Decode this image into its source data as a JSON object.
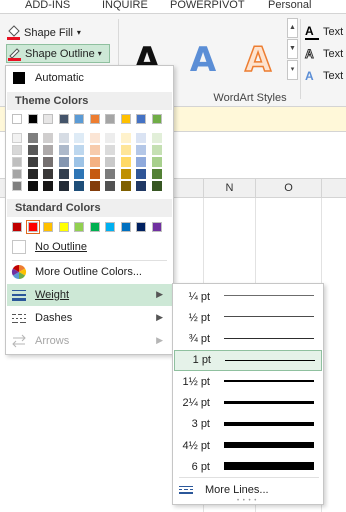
{
  "ribbon": {
    "tabs": [
      "ADD-INS",
      "INQUIRE",
      "POWERPIVOT",
      "Personal"
    ],
    "shape_fill_label": "Shape Fill",
    "shape_outline_label": "Shape Outline",
    "wordart_letter": "A",
    "text_commands": [
      "Text",
      "Text",
      "Text"
    ],
    "wordart_group_label": "WordArt Styles",
    "wordart_styles": [
      "black-plain",
      "blue-gradient",
      "orange-outline"
    ]
  },
  "sheet": {
    "columns": [
      "N",
      "O"
    ]
  },
  "outline_menu": {
    "automatic_label": "Automatic",
    "theme_colors_heading": "Theme Colors",
    "standard_colors_heading": "Standard Colors",
    "no_outline_label": "No Outline",
    "more_colors_label": "More Outline Colors...",
    "weight_label": "Weight",
    "dashes_label": "Dashes",
    "arrows_label": "Arrows",
    "theme_colors": [
      "#ffffff",
      "#000000",
      "#e7e6e6",
      "#44546a",
      "#5b9bd5",
      "#ed7d31",
      "#a5a5a5",
      "#ffc000",
      "#4472c4",
      "#70ad47"
    ],
    "theme_shades": [
      [
        "#f2f2f2",
        "#d8d8d8",
        "#bfbfbf",
        "#a5a5a5",
        "#7f7f7f"
      ],
      [
        "#7f7f7f",
        "#595959",
        "#3f3f3f",
        "#262626",
        "#0c0c0c"
      ],
      [
        "#d0cece",
        "#aeaaaa",
        "#757070",
        "#3a3838",
        "#171616"
      ],
      [
        "#d6dce4",
        "#adb9ca",
        "#8496b0",
        "#323f4f",
        "#222a35"
      ],
      [
        "#deebf6",
        "#bdd7ee",
        "#9dc3e6",
        "#2e75b5",
        "#1e4e79"
      ],
      [
        "#fbe5d5",
        "#f7cbac",
        "#f4b183",
        "#c55a11",
        "#833c0b"
      ],
      [
        "#ededed",
        "#dbdbdb",
        "#c9c9c9",
        "#7b7b7b",
        "#525252"
      ],
      [
        "#fff2cc",
        "#fee599",
        "#ffd965",
        "#bf9000",
        "#7f6000"
      ],
      [
        "#dae3f3",
        "#b4c7e7",
        "#8faadc",
        "#2f5597",
        "#203864"
      ],
      [
        "#e2efd9",
        "#c5e0b3",
        "#a8d08d",
        "#538135",
        "#375623"
      ]
    ],
    "standard_colors": [
      "#c00000",
      "#ff0000",
      "#ffc000",
      "#ffff00",
      "#92d050",
      "#00b050",
      "#00b0f0",
      "#0070c0",
      "#002060",
      "#7030a0"
    ],
    "selected_standard_color": "#ff0000"
  },
  "weight_menu": {
    "items": [
      {
        "label": "¼ pt",
        "weight": 0.25
      },
      {
        "label": "½ pt",
        "weight": 0.5
      },
      {
        "label": "¾ pt",
        "weight": 0.75
      },
      {
        "label": "1 pt",
        "weight": 1,
        "selected": true
      },
      {
        "label": "1½ pt",
        "weight": 1.5
      },
      {
        "label": "2¼ pt",
        "weight": 2.25
      },
      {
        "label": "3 pt",
        "weight": 3
      },
      {
        "label": "4½ pt",
        "weight": 4.5
      },
      {
        "label": "6 pt",
        "weight": 6
      }
    ],
    "more_lines_label": "More Lines..."
  },
  "colors": {
    "accent_green": "#cde8d6",
    "outline_red": "#e81123"
  }
}
